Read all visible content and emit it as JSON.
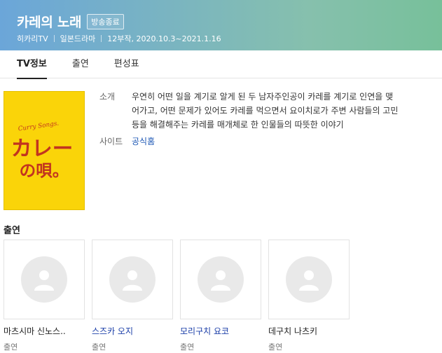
{
  "header": {
    "title": "카레의 노래",
    "status_badge": "방송종료",
    "channel": "히카리TV",
    "genre": "일본드라마",
    "schedule": "12부작, 2020.10.3~2021.1.16"
  },
  "tabs": [
    {
      "label": "TV정보",
      "active": true
    },
    {
      "label": "출연",
      "active": false
    },
    {
      "label": "편성표",
      "active": false
    }
  ],
  "poster": {
    "text_top": "Curry Songs.",
    "text_main_1": "カレー",
    "text_main_2": "の唄。",
    "bg_color": "#fad409"
  },
  "info": {
    "summary_label": "소개",
    "summary_lines": [
      "우연히 어떤 일을 계기로 알게 된 두 남자주인공이 카레를 계기로 인연을 맺",
      "어가고, 어떤 문제가 있어도 카레를 먹으면서 요이치로가 주변 사람들의 고민",
      "등을 해결해주는 카레를 매개체로 한 인물들의 따뜻한 이야기"
    ],
    "site_label": "사이트",
    "site_link": "공식홈"
  },
  "cast": {
    "heading": "출연",
    "members": [
      {
        "name": "마츠시마 신노스..",
        "role": "출연",
        "link": false
      },
      {
        "name": "스즈카 오지",
        "role": "출연",
        "link": true
      },
      {
        "name": "모리구치 요코",
        "role": "출연",
        "link": true
      },
      {
        "name": "데구치 나츠키",
        "role": "출연",
        "link": false
      }
    ]
  }
}
